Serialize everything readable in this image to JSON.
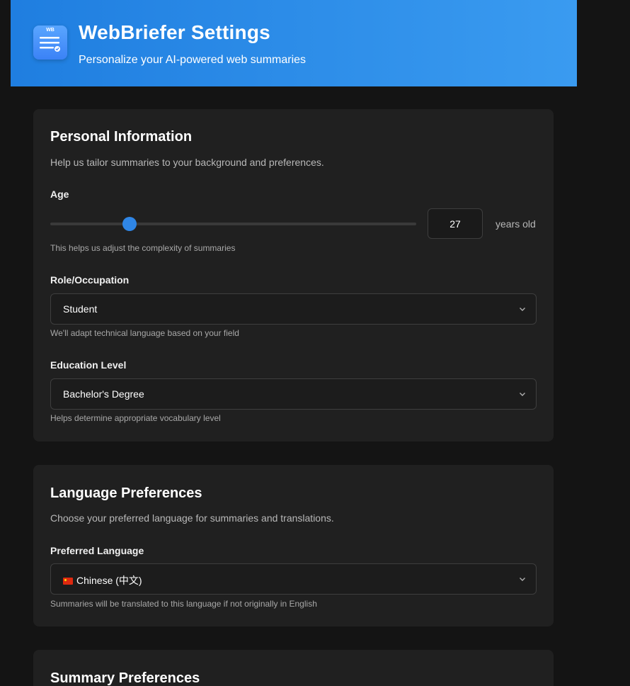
{
  "header": {
    "logo_text": "WB",
    "title": "WebBriefer Settings",
    "subtitle": "Personalize your AI-powered web summaries",
    "gradient_start": "#1f7ee0",
    "gradient_end": "#3a9bf0"
  },
  "personal": {
    "title": "Personal Information",
    "description": "Help us tailor summaries to your background and preferences.",
    "age": {
      "label": "Age",
      "value": "27",
      "unit": "years old",
      "helper": "This helps us adjust the complexity of summaries"
    },
    "role": {
      "label": "Role/Occupation",
      "value": "Student",
      "helper": "We'll adapt technical language based on your field"
    },
    "education": {
      "label": "Education Level",
      "value": "Bachelor's Degree",
      "helper": "Helps determine appropriate vocabulary level"
    }
  },
  "language": {
    "title": "Language Preferences",
    "description": "Choose your preferred language for summaries and translations.",
    "preferred": {
      "label": "Preferred Language",
      "value": "Chinese (中文)",
      "flag_icon": "china-flag-icon",
      "helper": "Summaries will be translated to this language if not originally in English"
    }
  },
  "summary": {
    "title": "Summary Preferences"
  },
  "colors": {
    "accent": "#2f86e6",
    "background": "#141414",
    "card": "#202020"
  }
}
